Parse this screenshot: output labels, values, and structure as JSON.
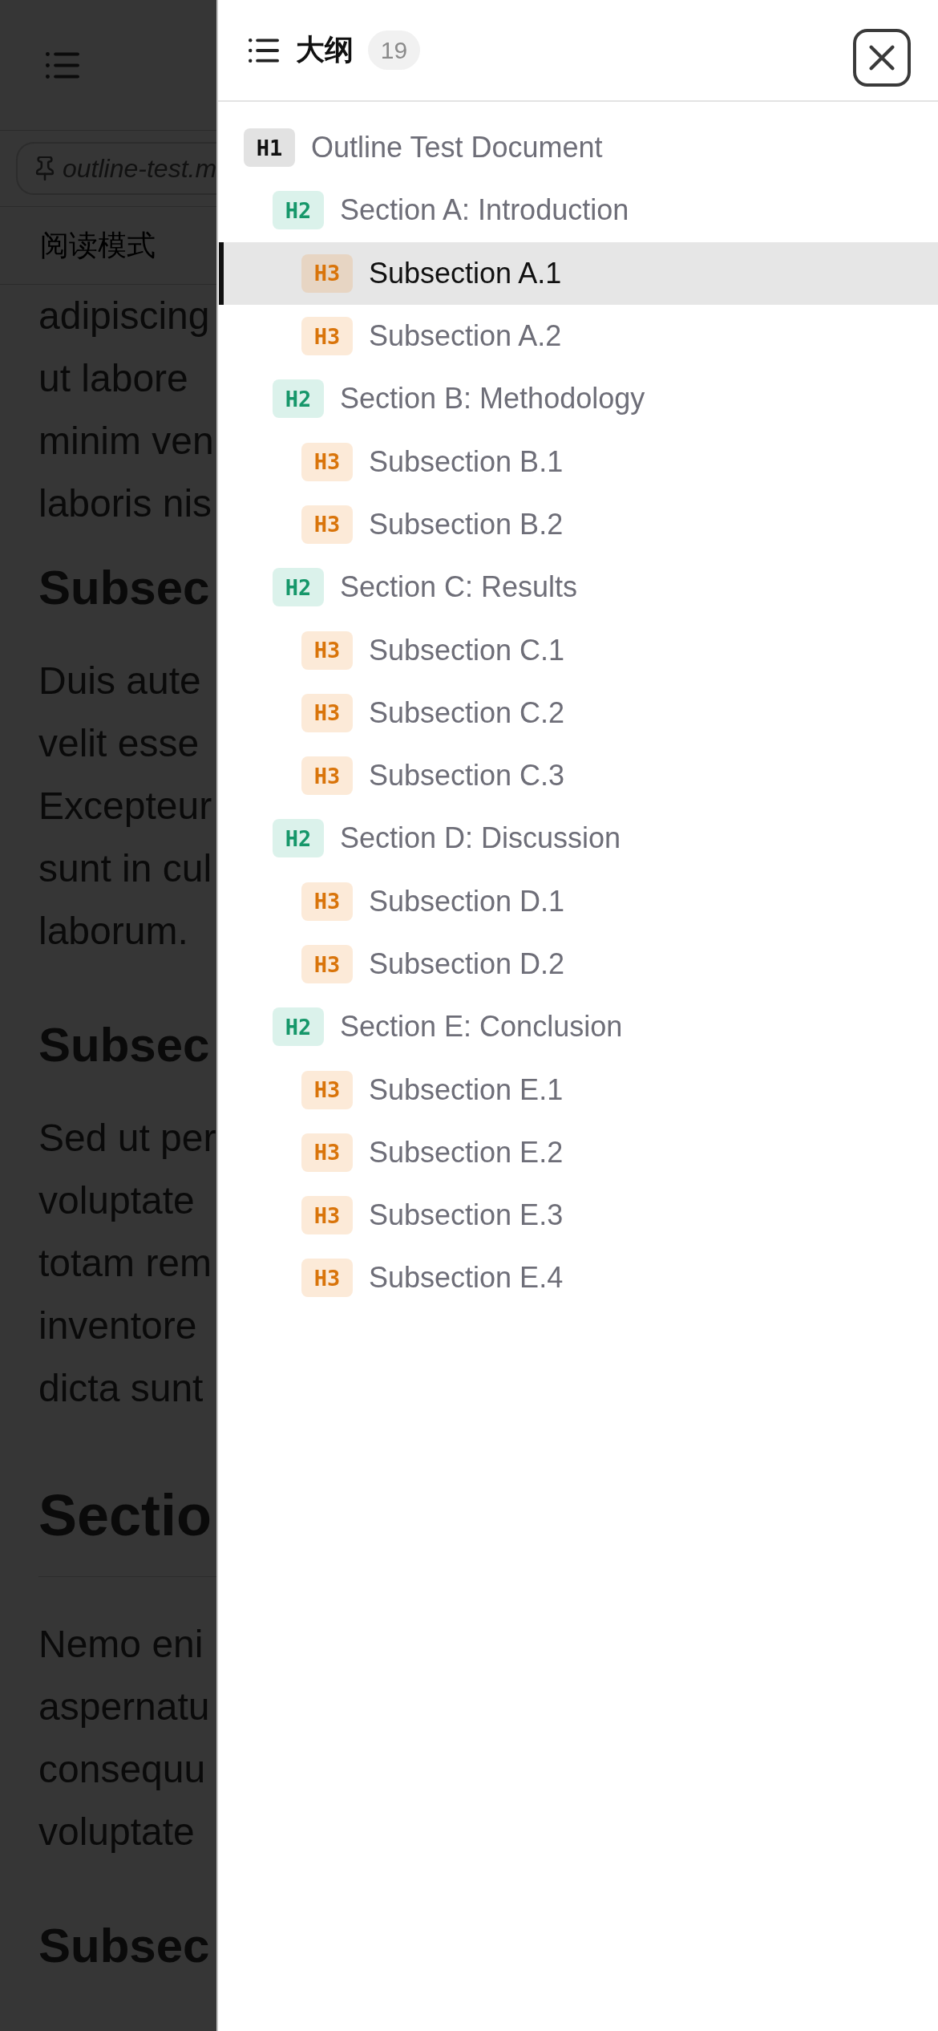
{
  "file_tab": {
    "name": "outline-test.m"
  },
  "mode_bar": {
    "label": "阅读模式"
  },
  "document": {
    "blocks": [
      {
        "kind": "paragraph",
        "lines": [
          "adipiscing",
          "ut labore",
          "minim ven",
          "laboris nis"
        ]
      },
      {
        "kind": "h3",
        "text": "Subsec"
      },
      {
        "kind": "paragraph",
        "lines": [
          "Duis aute",
          "velit esse",
          "Excepteur",
          "sunt in cul",
          "laborum."
        ]
      },
      {
        "kind": "h3",
        "text": "Subsec"
      },
      {
        "kind": "paragraph",
        "lines": [
          "Sed ut per",
          "voluptate",
          "totam rem",
          "inventore",
          "dicta sunt"
        ]
      },
      {
        "kind": "h2",
        "text": "Sectio"
      },
      {
        "kind": "paragraph",
        "lines": [
          "Nemo eni",
          "aspernatu",
          "consequu",
          "voluptate"
        ]
      },
      {
        "kind": "h3",
        "text": "Subsec"
      }
    ]
  },
  "outline_panel": {
    "title": "大纲",
    "count": "19",
    "items": [
      {
        "badge": "H1",
        "label": "Outline Test Document",
        "selected": false,
        "children": [
          {
            "badge": "H2",
            "label": "Section A: Introduction",
            "selected": false,
            "children": [
              {
                "badge": "H3",
                "label": "Subsection A.1",
                "selected": true
              },
              {
                "badge": "H3",
                "label": "Subsection A.2",
                "selected": false
              }
            ]
          },
          {
            "badge": "H2",
            "label": "Section B: Methodology",
            "selected": false,
            "children": [
              {
                "badge": "H3",
                "label": "Subsection B.1",
                "selected": false
              },
              {
                "badge": "H3",
                "label": "Subsection B.2",
                "selected": false
              }
            ]
          },
          {
            "badge": "H2",
            "label": "Section C: Results",
            "selected": false,
            "children": [
              {
                "badge": "H3",
                "label": "Subsection C.1",
                "selected": false
              },
              {
                "badge": "H3",
                "label": "Subsection C.2",
                "selected": false
              },
              {
                "badge": "H3",
                "label": "Subsection C.3",
                "selected": false
              }
            ]
          },
          {
            "badge": "H2",
            "label": "Section D: Discussion",
            "selected": false,
            "children": [
              {
                "badge": "H3",
                "label": "Subsection D.1",
                "selected": false
              },
              {
                "badge": "H3",
                "label": "Subsection D.2",
                "selected": false
              }
            ]
          },
          {
            "badge": "H2",
            "label": "Section E: Conclusion",
            "selected": false,
            "children": [
              {
                "badge": "H3",
                "label": "Subsection E.1",
                "selected": false
              },
              {
                "badge": "H3",
                "label": "Subsection E.2",
                "selected": false
              },
              {
                "badge": "H3",
                "label": "Subsection E.3",
                "selected": false
              },
              {
                "badge": "H3",
                "label": "Subsection E.4",
                "selected": false
              }
            ]
          }
        ]
      }
    ]
  }
}
